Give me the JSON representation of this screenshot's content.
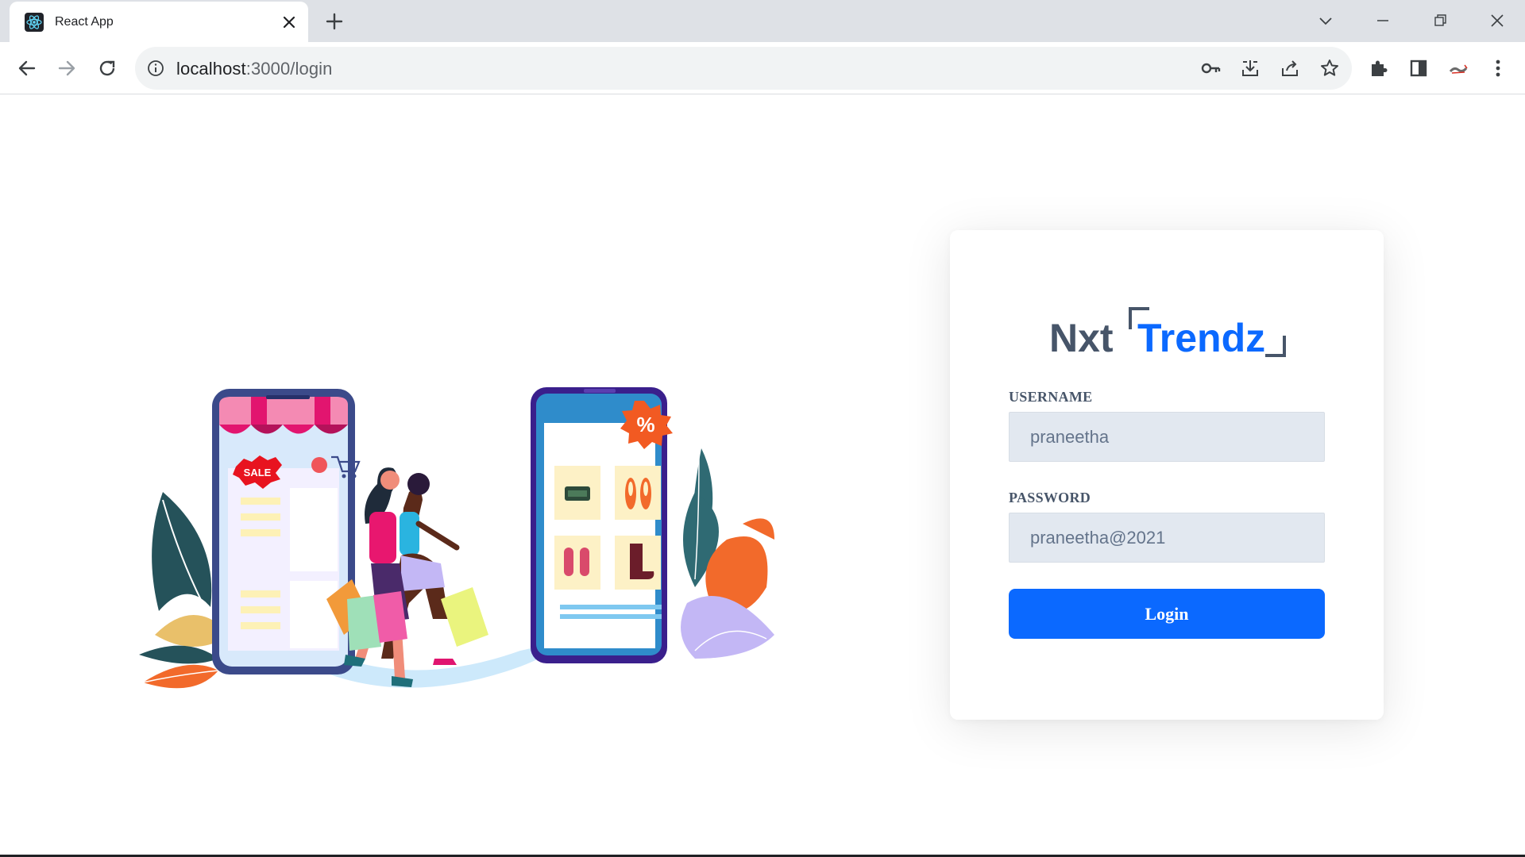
{
  "browser": {
    "tab_title": "React App",
    "url_host": "localhost",
    "url_path": ":3000/login"
  },
  "icons": {
    "tab": [
      "react-favicon",
      "close-icon",
      "plus-icon"
    ],
    "window": [
      "chevron-down-icon",
      "minimize-icon",
      "restore-icon",
      "close-icon"
    ],
    "nav": [
      "back-arrow-icon",
      "forward-arrow-icon",
      "reload-icon",
      "info-icon"
    ],
    "omnibox": [
      "key-icon",
      "install-icon",
      "share-icon",
      "star-icon"
    ],
    "toolbar": [
      "puzzle-icon",
      "side-panel-icon",
      "profile-avatar",
      "more-vert-icon"
    ]
  },
  "illustration": {
    "sale_badge": "SALE",
    "discount_badge": "%"
  },
  "login": {
    "logo_left": "Nxt",
    "logo_right": "Trendz",
    "username_label": "USERNAME",
    "username_value": "praneetha",
    "password_label": "PASSWORD",
    "password_value": "praneetha@2021",
    "button_label": "Login"
  },
  "colors": {
    "primary": "#0b69ff",
    "label": "#475569",
    "input_bg": "#e2e8f0"
  }
}
